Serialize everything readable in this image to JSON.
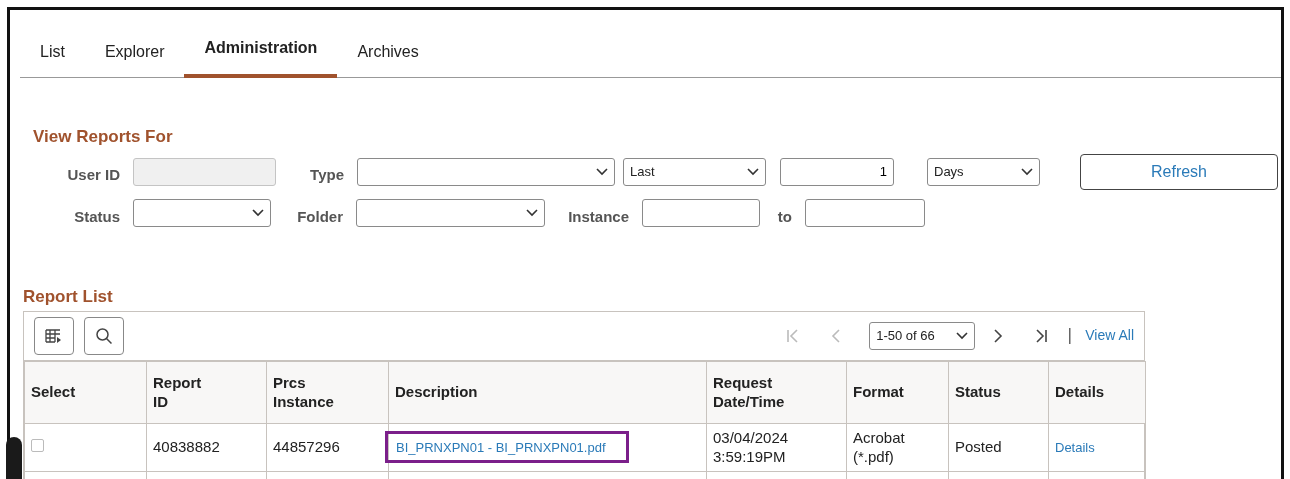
{
  "tabs": [
    {
      "label": "List",
      "selected": false
    },
    {
      "label": "Explorer",
      "selected": false
    },
    {
      "label": "Administration",
      "selected": true
    },
    {
      "label": "Archives",
      "selected": false
    }
  ],
  "view_reports_for": {
    "title": "View Reports For",
    "user_id": {
      "label": "User ID",
      "disabled": true
    },
    "type": {
      "label": "Type"
    },
    "period": {
      "value": "Last"
    },
    "count": {
      "value": "1"
    },
    "unit": {
      "value": "Days"
    },
    "refresh_button": "Refresh",
    "status": {
      "label": "Status"
    },
    "folder": {
      "label": "Folder"
    },
    "instance": {
      "label": "Instance"
    },
    "to": {
      "label": "to"
    }
  },
  "report_list": {
    "title": "Report List",
    "pagination": {
      "first_disabled": true,
      "previous_disabled": true,
      "next_disabled": false,
      "last_disabled": false,
      "range": "1-50 of 66",
      "view_all": "View All"
    },
    "columns": [
      "Select",
      "Report ID",
      "Prcs Instance",
      "Description",
      "Request Date/Time",
      "Format",
      "Status",
      "Details"
    ],
    "rows": [
      {
        "checked": false,
        "report_id": "40838882",
        "prcs_instance": "44857296",
        "description": "BI_PRNXPN01 - BI_PRNXPN01.pdf",
        "highlighted": true,
        "request_date": "03/04/2024",
        "request_time": "3:59:19PM",
        "format": "Acrobat (*.pdf)",
        "status": "Posted",
        "details": "Details"
      }
    ]
  }
}
